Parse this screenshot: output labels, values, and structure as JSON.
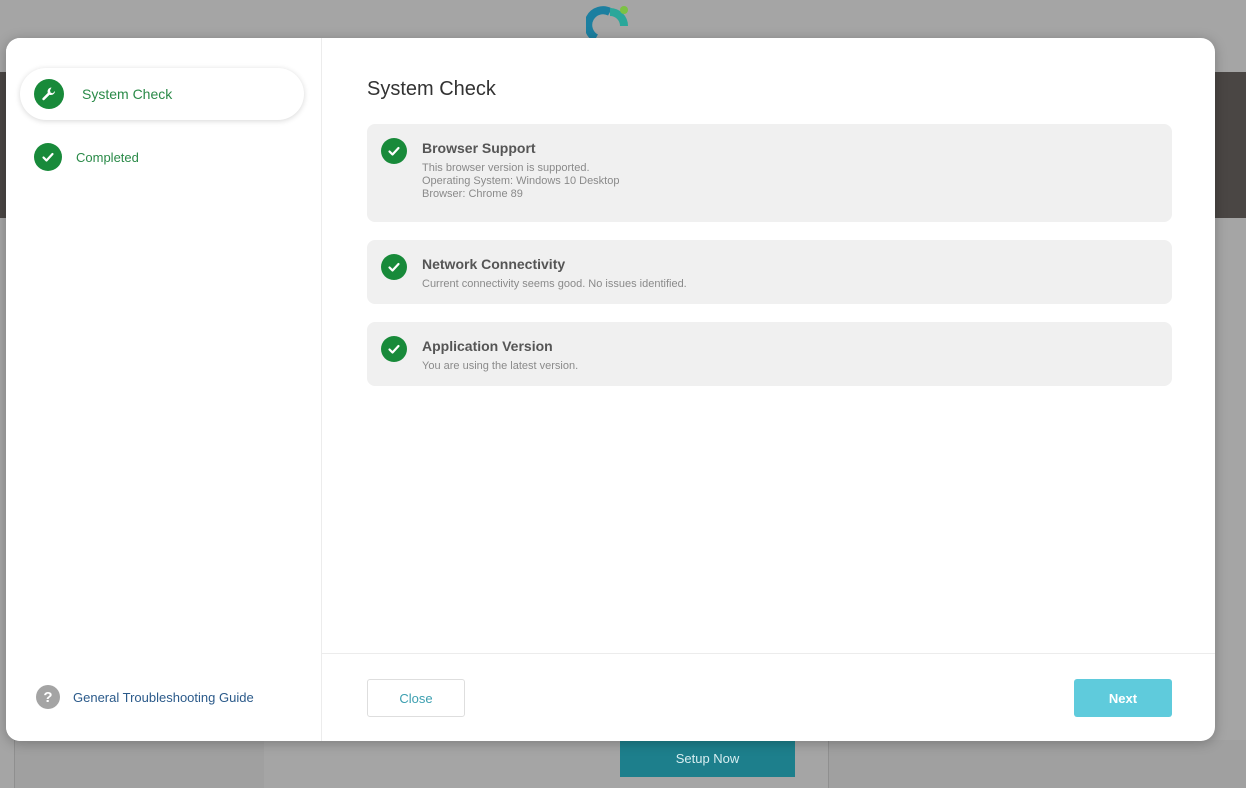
{
  "background": {
    "setup_button_label": "Setup Now"
  },
  "sidebar": {
    "steps": [
      {
        "label": "System Check",
        "icon": "wrench-icon",
        "state": "active"
      },
      {
        "label": "Completed",
        "icon": "check-icon",
        "state": "done"
      }
    ],
    "guide_label": "General Troubleshooting Guide",
    "guide_icon": "question-icon"
  },
  "main": {
    "title": "System Check",
    "checks": [
      {
        "title": "Browser Support",
        "lines": [
          "This browser version is supported.",
          "Operating System: Windows 10 Desktop",
          "Browser: Chrome 89"
        ]
      },
      {
        "title": "Network Connectivity",
        "lines": [
          "Current connectivity seems good. No issues identified."
        ]
      },
      {
        "title": "Application Version",
        "lines": [
          "You are using the latest version."
        ]
      }
    ]
  },
  "footer": {
    "close_label": "Close",
    "next_label": "Next"
  },
  "colors": {
    "success_green": "#188a3a",
    "accent_teal": "#5fcbdc",
    "link_blue": "#2b5a8a"
  }
}
